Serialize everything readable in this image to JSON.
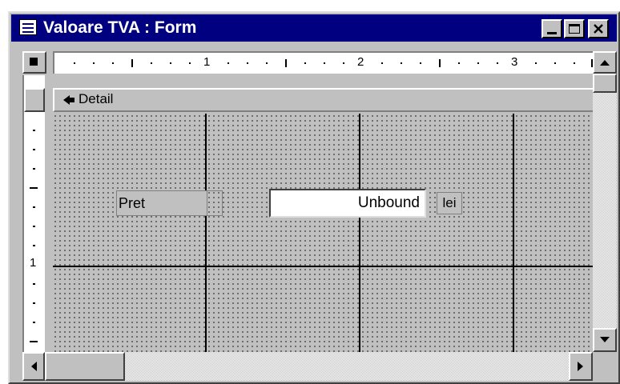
{
  "window": {
    "title": "Valoare TVA : Form",
    "title_bar_color": "#000080",
    "face_color": "#c0c0c0",
    "controls": [
      "minimize-icon",
      "maximize-icon",
      "close-icon"
    ]
  },
  "ruler": {
    "horizontal_labels": [
      "1",
      "2",
      "3"
    ],
    "vertical_labels": [
      "1"
    ]
  },
  "section": {
    "label": "Detail",
    "icon": "section-arrow-icon"
  },
  "controls": {
    "pret_label": "Pret",
    "textbox_value": "Unbound",
    "unit_label": "lei"
  },
  "scrollbars": {
    "vertical": [
      "up-arrow-icon",
      "down-arrow-icon"
    ],
    "horizontal": [
      "left-arrow-icon",
      "right-arrow-icon"
    ]
  }
}
